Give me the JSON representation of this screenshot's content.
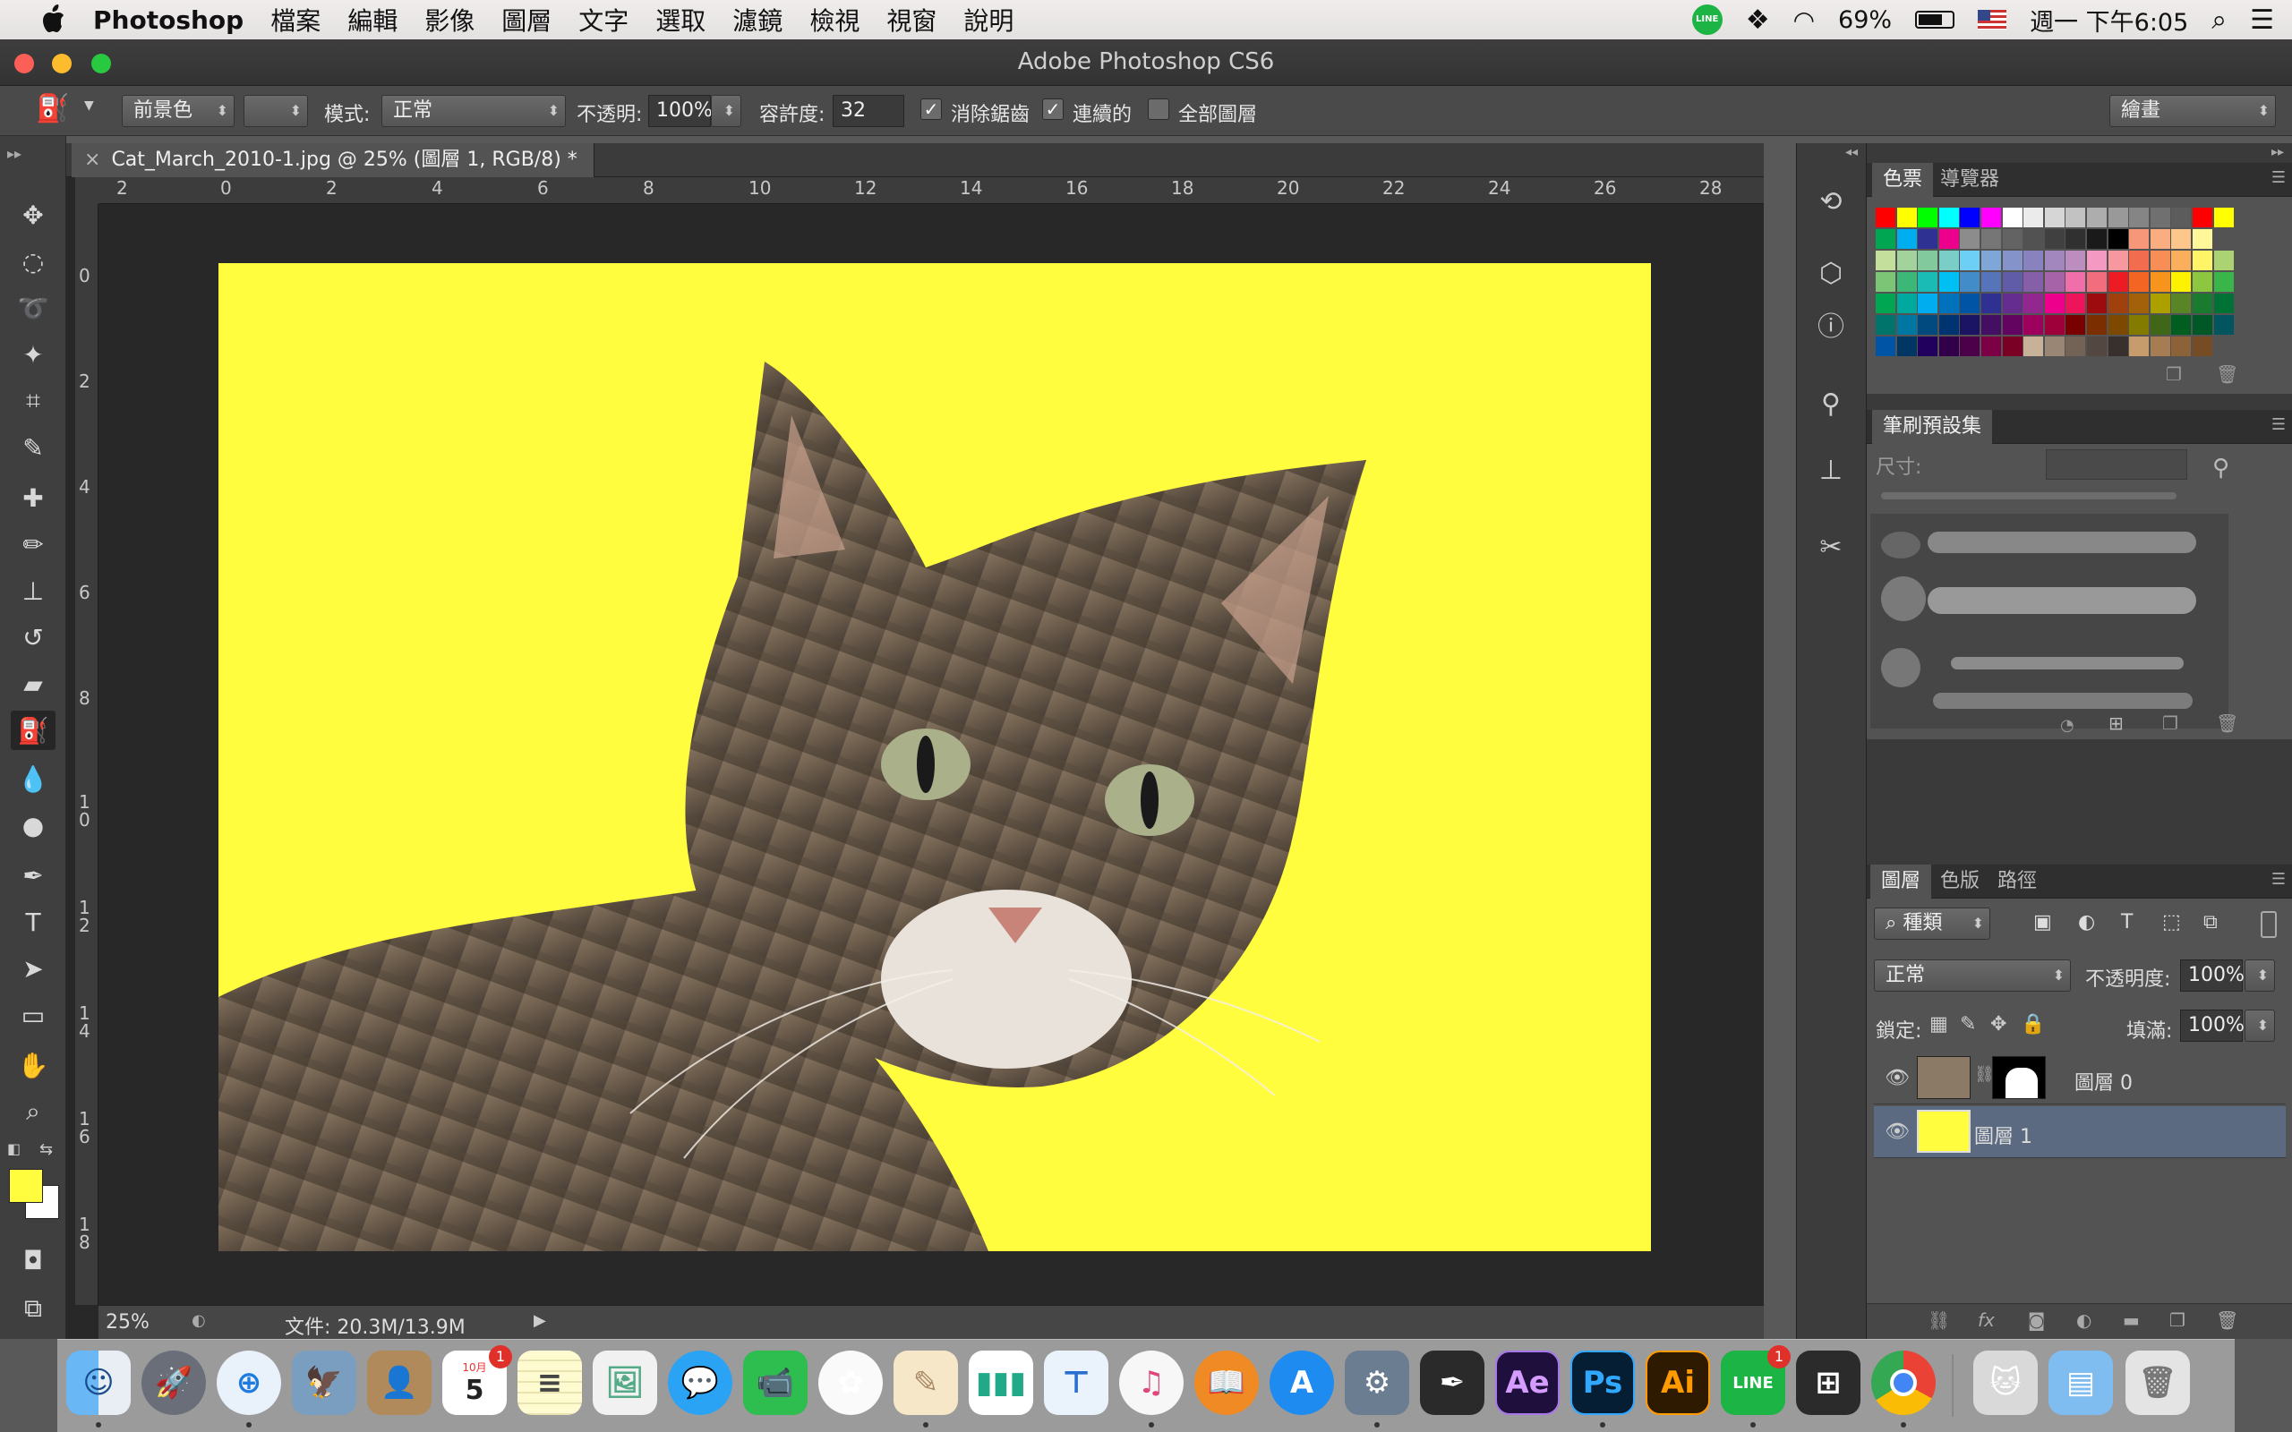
{
  "menubar": {
    "app": "Photoshop",
    "items": [
      "檔案",
      "編輯",
      "影像",
      "圖層",
      "文字",
      "選取",
      "濾鏡",
      "檢視",
      "視窗",
      "說明"
    ],
    "battery": "69%",
    "clock": "週一 下午6:05"
  },
  "window": {
    "title": "Adobe Photoshop CS6"
  },
  "options": {
    "fill_source": "前景色",
    "mode_label": "模式:",
    "mode_value": "正常",
    "opacity_label": "不透明:",
    "opacity_value": "100%",
    "tolerance_label": "容許度:",
    "tolerance_value": "32",
    "antialias_label": "消除鋸齒",
    "contiguous_label": "連續的",
    "all_layers_label": "全部圖層",
    "workspace": "繪畫"
  },
  "document": {
    "tab_title": "Cat_March_2010-1.jpg @ 25% (圖層 1, RGB/8) *",
    "zoom": "25%",
    "file_info": "文件: 20.3M/13.9M",
    "ruler_h": [
      "2",
      "0",
      "2",
      "4",
      "6",
      "8",
      "10",
      "12",
      "14",
      "16",
      "18",
      "20",
      "22",
      "24",
      "26",
      "28"
    ],
    "ruler_v": [
      "0",
      "2",
      "4",
      "6",
      "8",
      "1 0",
      "1 2",
      "1 4",
      "1 6",
      "1 8"
    ],
    "canvas_bg": "#fffd3d"
  },
  "panels": {
    "swatches_tabs": [
      "色票",
      "導覽器"
    ],
    "brush_tab": "筆刷預設集",
    "brush_size_label": "尺寸:",
    "layers_tabs": [
      "圖層",
      "色版",
      "路徑"
    ],
    "layer_filter": "種類",
    "blend_mode": "正常",
    "opacity_label": "不透明度:",
    "opacity_value": "100%",
    "lock_label": "鎖定:",
    "fill_label": "填滿:",
    "fill_value": "100%",
    "layers": [
      {
        "name": "圖層 0",
        "selected": false
      },
      {
        "name": "圖層 1",
        "selected": true
      }
    ]
  },
  "dock": {
    "calendar_month": "10月",
    "calendar_day": "5",
    "calendar_badge": "1",
    "line_badge": "1",
    "ae": "Ae",
    "ps": "Ps",
    "ai": "Ai",
    "line": "LINE"
  },
  "colors": {
    "foreground": "#fffd3d",
    "background": "#ffffff"
  }
}
